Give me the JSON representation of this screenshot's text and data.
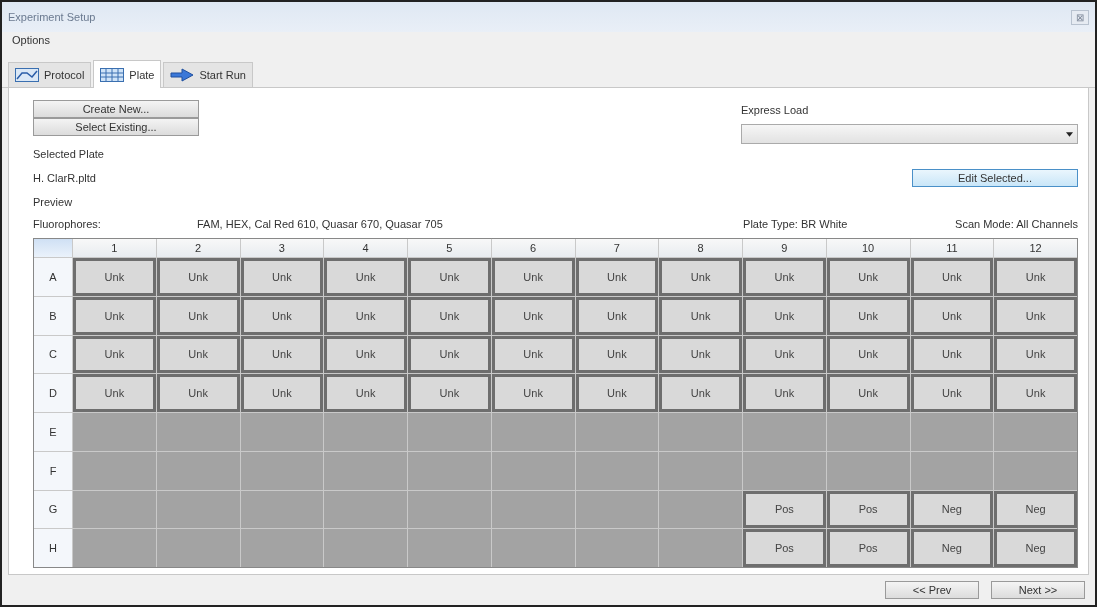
{
  "window": {
    "title": "Experiment Setup",
    "close": "⊠"
  },
  "menu": [
    "Options"
  ],
  "tabs": [
    {
      "label": "Protocol",
      "kind": "protocol",
      "selected": false
    },
    {
      "label": "Plate",
      "kind": "plate",
      "selected": true
    },
    {
      "label": "Start Run",
      "kind": "run",
      "selected": false
    }
  ],
  "buttons_left": [
    "Create New...",
    "Select Existing..."
  ],
  "express_load": {
    "label": "Express Load"
  },
  "selected_plate": {
    "label": "Selected Plate",
    "value": "H. ClarR.pltd"
  },
  "edit_button": "Edit Selected...",
  "preview": {
    "label": "Preview",
    "fluorophores_label": "Fluorophores:",
    "fluorophores": "FAM, HEX, Cal Red 610, Quasar 670, Quasar 705",
    "plate_type": "Plate Type: BR White",
    "scan_mode": "Scan Mode: All Channels"
  },
  "plate": {
    "columns": [
      "1",
      "2",
      "3",
      "4",
      "5",
      "6",
      "7",
      "8",
      "9",
      "10",
      "11",
      "12"
    ],
    "rows": [
      {
        "label": "A",
        "wells": [
          {
            "kind": "sample",
            "label": "Unk"
          },
          {
            "kind": "sample",
            "label": "Unk"
          },
          {
            "kind": "sample",
            "label": "Unk"
          },
          {
            "kind": "sample",
            "label": "Unk"
          },
          {
            "kind": "sample",
            "label": "Unk"
          },
          {
            "kind": "sample",
            "label": "Unk"
          },
          {
            "kind": "sample",
            "label": "Unk"
          },
          {
            "kind": "sample",
            "label": "Unk"
          },
          {
            "kind": "sample",
            "label": "Unk"
          },
          {
            "kind": "sample",
            "label": "Unk"
          },
          {
            "kind": "sample",
            "label": "Unk"
          },
          {
            "kind": "sample",
            "label": "Unk"
          }
        ]
      },
      {
        "label": "B",
        "wells": [
          {
            "kind": "sample",
            "label": "Unk"
          },
          {
            "kind": "sample",
            "label": "Unk"
          },
          {
            "kind": "sample",
            "label": "Unk"
          },
          {
            "kind": "sample",
            "label": "Unk"
          },
          {
            "kind": "sample",
            "label": "Unk"
          },
          {
            "kind": "sample",
            "label": "Unk"
          },
          {
            "kind": "sample",
            "label": "Unk"
          },
          {
            "kind": "sample",
            "label": "Unk"
          },
          {
            "kind": "sample",
            "label": "Unk"
          },
          {
            "kind": "sample",
            "label": "Unk"
          },
          {
            "kind": "sample",
            "label": "Unk"
          },
          {
            "kind": "sample",
            "label": "Unk"
          }
        ]
      },
      {
        "label": "C",
        "wells": [
          {
            "kind": "sample",
            "label": "Unk"
          },
          {
            "kind": "sample",
            "label": "Unk"
          },
          {
            "kind": "sample",
            "label": "Unk"
          },
          {
            "kind": "sample",
            "label": "Unk"
          },
          {
            "kind": "sample",
            "label": "Unk"
          },
          {
            "kind": "sample",
            "label": "Unk"
          },
          {
            "kind": "sample",
            "label": "Unk"
          },
          {
            "kind": "sample",
            "label": "Unk"
          },
          {
            "kind": "sample",
            "label": "Unk"
          },
          {
            "kind": "sample",
            "label": "Unk"
          },
          {
            "kind": "sample",
            "label": "Unk"
          },
          {
            "kind": "sample",
            "label": "Unk"
          }
        ]
      },
      {
        "label": "D",
        "wells": [
          {
            "kind": "sample",
            "label": "Unk"
          },
          {
            "kind": "sample",
            "label": "Unk"
          },
          {
            "kind": "sample",
            "label": "Unk"
          },
          {
            "kind": "sample",
            "label": "Unk"
          },
          {
            "kind": "sample",
            "label": "Unk"
          },
          {
            "kind": "sample",
            "label": "Unk"
          },
          {
            "kind": "sample",
            "label": "Unk"
          },
          {
            "kind": "sample",
            "label": "Unk"
          },
          {
            "kind": "sample",
            "label": "Unk"
          },
          {
            "kind": "sample",
            "label": "Unk"
          },
          {
            "kind": "sample",
            "label": "Unk"
          },
          {
            "kind": "sample",
            "label": "Unk"
          }
        ]
      },
      {
        "label": "E",
        "wells": [
          {
            "kind": "empty"
          },
          {
            "kind": "empty"
          },
          {
            "kind": "empty"
          },
          {
            "kind": "empty"
          },
          {
            "kind": "empty"
          },
          {
            "kind": "empty"
          },
          {
            "kind": "empty"
          },
          {
            "kind": "empty"
          },
          {
            "kind": "empty"
          },
          {
            "kind": "empty"
          },
          {
            "kind": "empty"
          },
          {
            "kind": "empty"
          }
        ]
      },
      {
        "label": "F",
        "wells": [
          {
            "kind": "empty"
          },
          {
            "kind": "empty"
          },
          {
            "kind": "empty"
          },
          {
            "kind": "empty"
          },
          {
            "kind": "empty"
          },
          {
            "kind": "empty"
          },
          {
            "kind": "empty"
          },
          {
            "kind": "empty"
          },
          {
            "kind": "empty"
          },
          {
            "kind": "empty"
          },
          {
            "kind": "empty"
          },
          {
            "kind": "empty"
          }
        ]
      },
      {
        "label": "G",
        "wells": [
          {
            "kind": "empty"
          },
          {
            "kind": "empty"
          },
          {
            "kind": "empty"
          },
          {
            "kind": "empty"
          },
          {
            "kind": "empty"
          },
          {
            "kind": "empty"
          },
          {
            "kind": "empty"
          },
          {
            "kind": "empty"
          },
          {
            "kind": "sample",
            "label": "Pos"
          },
          {
            "kind": "sample",
            "label": "Pos"
          },
          {
            "kind": "sample",
            "label": "Neg"
          },
          {
            "kind": "sample",
            "label": "Neg"
          }
        ]
      },
      {
        "label": "H",
        "wells": [
          {
            "kind": "empty"
          },
          {
            "kind": "empty"
          },
          {
            "kind": "empty"
          },
          {
            "kind": "empty"
          },
          {
            "kind": "empty"
          },
          {
            "kind": "empty"
          },
          {
            "kind": "empty"
          },
          {
            "kind": "empty"
          },
          {
            "kind": "sample",
            "label": "Pos"
          },
          {
            "kind": "sample",
            "label": "Pos"
          },
          {
            "kind": "sample",
            "label": "Neg"
          },
          {
            "kind": "sample",
            "label": "Neg"
          }
        ]
      }
    ]
  },
  "nav_buttons": [
    "<< Prev",
    "Next >>"
  ]
}
